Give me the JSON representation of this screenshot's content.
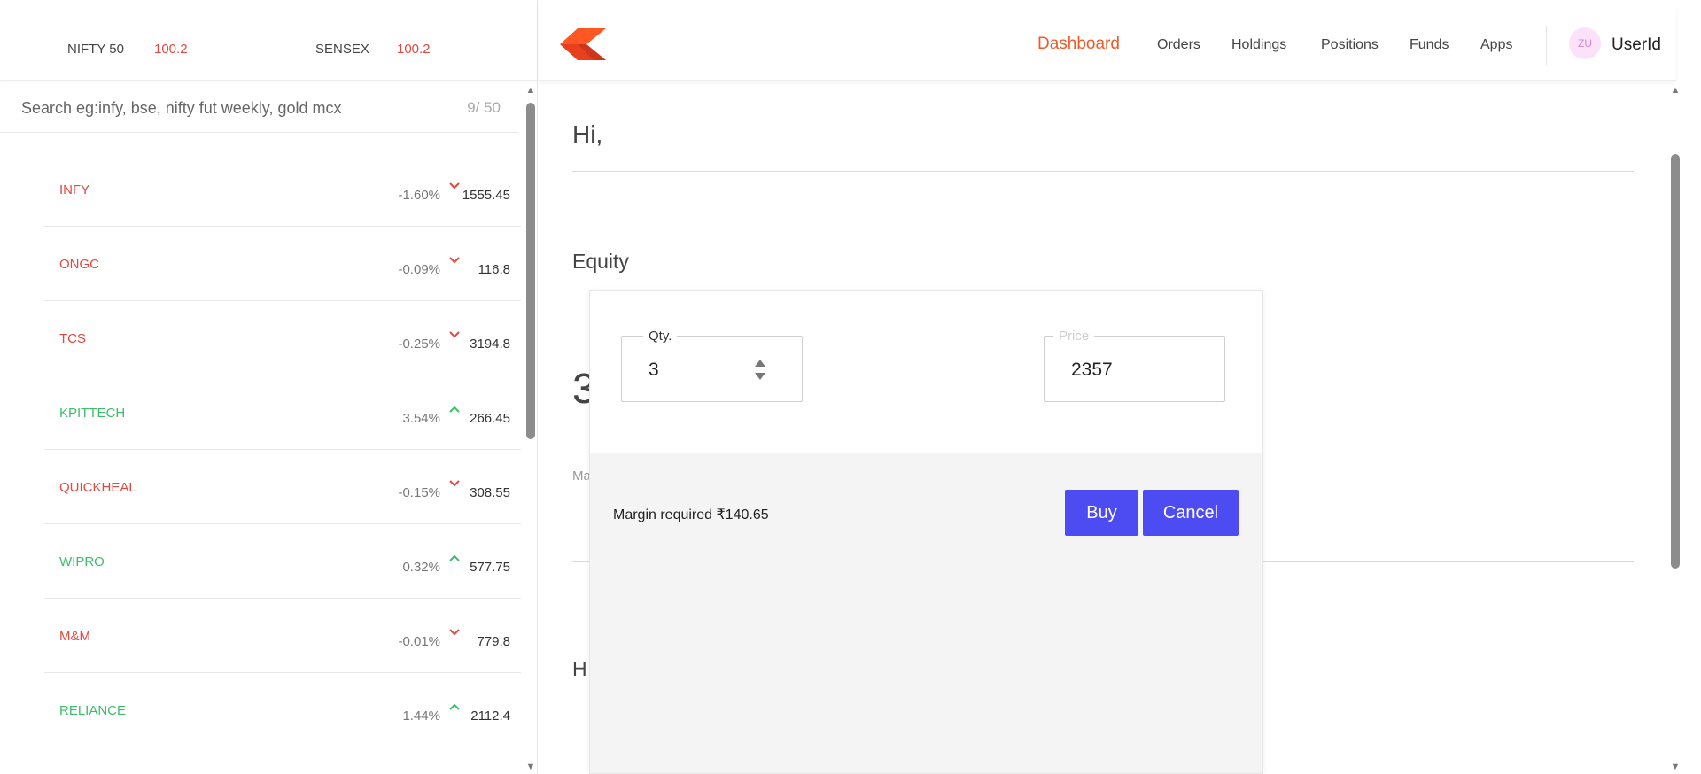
{
  "indices": [
    {
      "name": "NIFTY 50",
      "value": "100.2"
    },
    {
      "name": "SENSEX",
      "value": "100.2"
    }
  ],
  "search": {
    "placeholder": "Search eg:infy, bse, nifty fut weekly, gold mcx",
    "count": "9/ 50"
  },
  "watchlist": [
    {
      "name": "INFY",
      "change": "-1.60%",
      "price": "1555.45",
      "direction": "down"
    },
    {
      "name": "ONGC",
      "change": "-0.09%",
      "price": "116.8",
      "direction": "down"
    },
    {
      "name": "TCS",
      "change": "-0.25%",
      "price": "3194.8",
      "direction": "down"
    },
    {
      "name": "KPITTECH",
      "change": "3.54%",
      "price": "266.45",
      "direction": "up"
    },
    {
      "name": "QUICKHEAL",
      "change": "-0.15%",
      "price": "308.55",
      "direction": "down"
    },
    {
      "name": "WIPRO",
      "change": "0.32%",
      "price": "577.75",
      "direction": "up"
    },
    {
      "name": "M&M",
      "change": "-0.01%",
      "price": "779.8",
      "direction": "down"
    },
    {
      "name": "RELIANCE",
      "change": "1.44%",
      "price": "2112.4",
      "direction": "up"
    }
  ],
  "colors": {
    "down": "#e0493f",
    "up": "#3dbd6b",
    "brand": "#f05a28",
    "button": "#4d4cf3"
  },
  "nav": {
    "items": [
      "Dashboard",
      "Orders",
      "Holdings",
      "Positions",
      "Funds",
      "Apps"
    ],
    "active": "Dashboard",
    "avatar_initials": "ZU",
    "user_id": "UserId"
  },
  "main": {
    "greeting": "Hi,",
    "equity_title": "Equity",
    "equity_value_partial": "3",
    "margin_label_partial": "Ma",
    "holdings_title_partial": "H"
  },
  "order_modal": {
    "qty_label": "Qty.",
    "qty_value": "3",
    "price_label": "Price",
    "price_value": "2357",
    "margin_text": "Margin required ₹140.65",
    "buy_label": "Buy",
    "cancel_label": "Cancel"
  },
  "icons": {
    "logo": "kite-logo",
    "down_arrow": "chevron-down-icon",
    "up_arrow": "chevron-up-icon"
  }
}
